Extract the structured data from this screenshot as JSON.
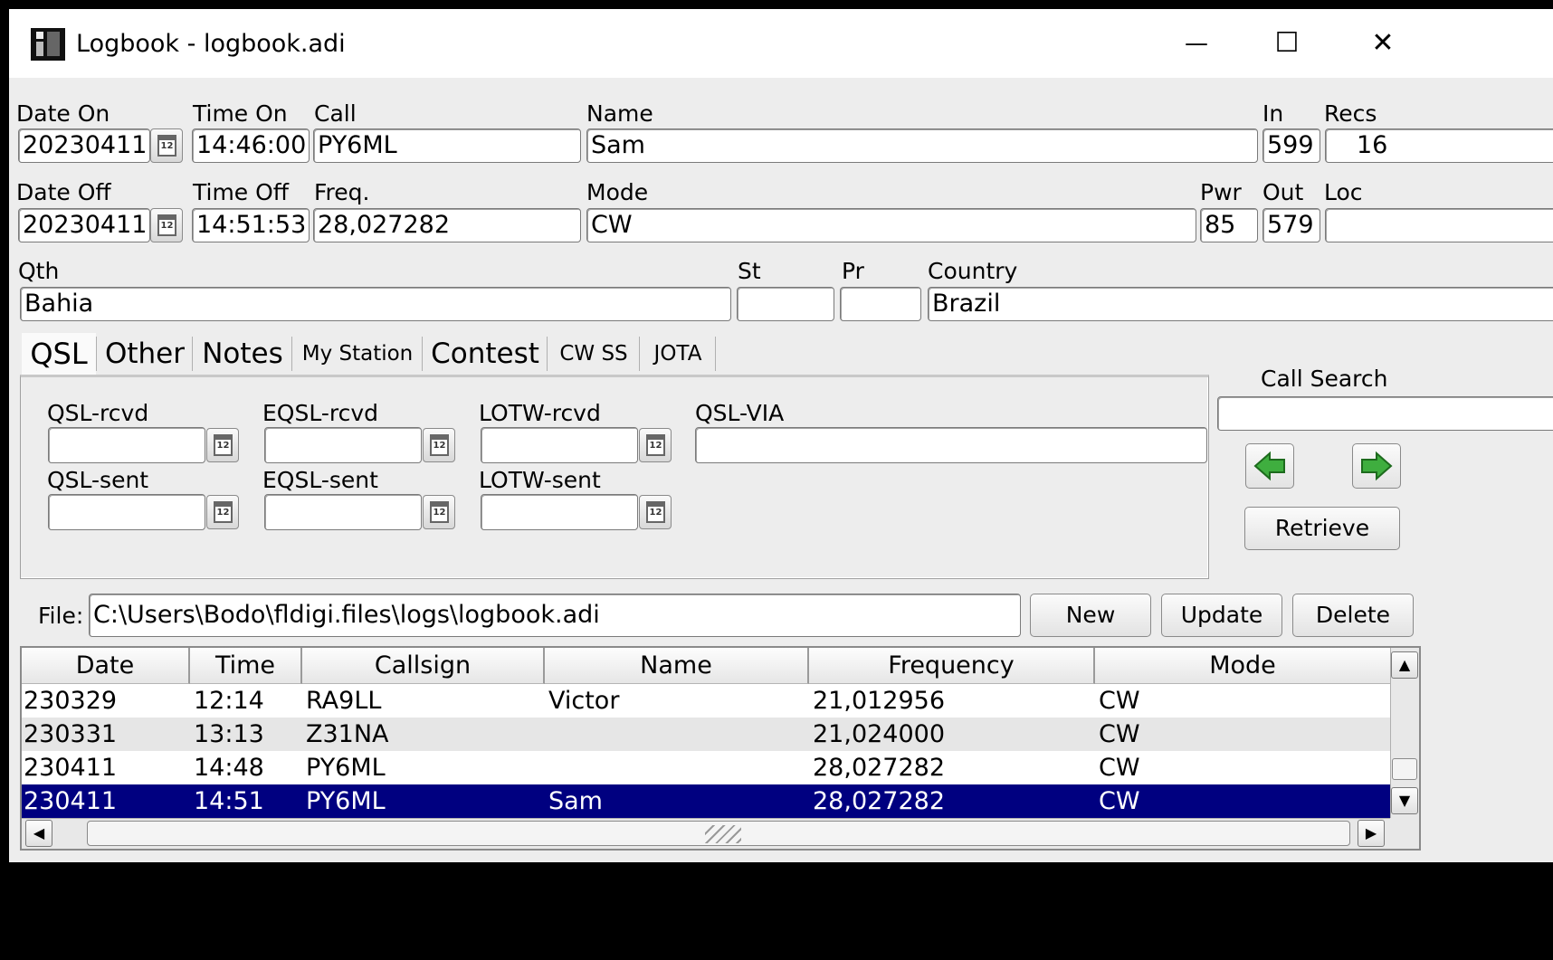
{
  "window": {
    "title": "Logbook - logbook.adi",
    "controls": {
      "minimize": "—",
      "maximize": "☐",
      "close": "✕"
    }
  },
  "qso": {
    "date_on_label": "Date On",
    "date_on": "20230411",
    "time_on_label": "Time On",
    "time_on": "14:46:00",
    "call_label": "Call",
    "call": "PY6ML",
    "name_label": "Name",
    "name": "Sam",
    "in_label": "In",
    "in": "599",
    "recs_label": "Recs",
    "recs": "16",
    "date_off_label": "Date Off",
    "date_off": "20230411",
    "time_off_label": "Time Off",
    "time_off": "14:51:53",
    "freq_label": "Freq.",
    "freq": "28,027282",
    "mode_label": "Mode",
    "mode": "CW",
    "pwr_label": "Pwr",
    "pwr": "85",
    "out_label": "Out",
    "out": "579",
    "loc_label": "Loc",
    "loc": "",
    "qth_label": "Qth",
    "qth": "Bahia",
    "st_label": "St",
    "st": "",
    "pr_label": "Pr",
    "pr": "",
    "country_label": "Country",
    "country": "Brazil"
  },
  "calendar_icon_text": "12",
  "tabs": [
    "QSL",
    "Other",
    "Notes",
    "My Station",
    "Contest",
    "CW SS",
    "JOTA"
  ],
  "qsl": {
    "qsl_rcvd_label": "QSL-rcvd",
    "eqsl_rcvd_label": "EQSL-rcvd",
    "lotw_rcvd_label": "LOTW-rcvd",
    "qsl_via_label": "QSL-VIA",
    "qsl_sent_label": "QSL-sent",
    "eqsl_sent_label": "EQSL-sent",
    "lotw_sent_label": "LOTW-sent"
  },
  "call_search": {
    "label": "Call Search",
    "value": "",
    "retrieve_label": "Retrieve"
  },
  "file": {
    "label": "File:",
    "path": "C:\\Users\\Bodo\\fldigi.files\\logs\\logbook.adi",
    "new_label": "New",
    "update_label": "Update",
    "delete_label": "Delete"
  },
  "table": {
    "headers": [
      "Date",
      "Time",
      "Callsign",
      "Name",
      "Frequency",
      "Mode"
    ],
    "rows": [
      [
        "230329",
        "12:14",
        "RA9LL",
        "Victor",
        "21,012956",
        "CW"
      ],
      [
        "230331",
        "13:13",
        "Z31NA",
        "",
        "21,024000",
        "CW"
      ],
      [
        "230411",
        "14:48",
        "PY6ML",
        "",
        "28,027282",
        "CW"
      ],
      [
        "230411",
        "14:51",
        "PY6ML",
        "Sam",
        "28,027282",
        "CW"
      ]
    ],
    "selected_row": 3
  },
  "colors": {
    "selection": "#000080",
    "row_alt": "#e6e6e6",
    "window_bg": "#ededed",
    "arrow_green": "#3fae3f"
  }
}
